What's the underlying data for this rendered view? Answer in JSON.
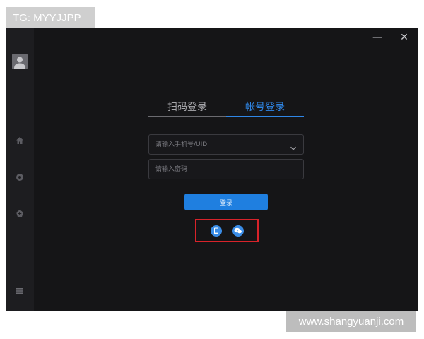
{
  "watermarks": {
    "tg": "TG: MYYJJPP",
    "site": "www.shangyuanji.com"
  },
  "window": {
    "minimize_glyph": "—",
    "close_glyph": "✕"
  },
  "sidebar": {
    "items": [
      {
        "icon": "avatar-icon"
      },
      {
        "icon": "home-icon"
      },
      {
        "icon": "record-icon"
      },
      {
        "icon": "gamepad-icon"
      },
      {
        "icon": "menu-icon"
      }
    ]
  },
  "login": {
    "tabs": [
      {
        "label": "扫码登录",
        "active": false
      },
      {
        "label": "帐号登录",
        "active": true
      }
    ],
    "account_placeholder": "请输入手机号/UID",
    "password_placeholder": "请输入密码",
    "submit_label": "登录",
    "alt_logins": [
      {
        "icon": "phone-icon"
      },
      {
        "icon": "wechat-icon"
      }
    ]
  },
  "colors": {
    "accent": "#2f86e6",
    "button": "#1f7fe0",
    "highlight": "#d8232a",
    "background": "#151517",
    "sidebar": "#1d1d20"
  }
}
